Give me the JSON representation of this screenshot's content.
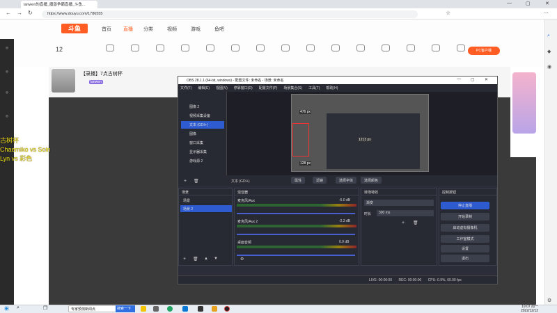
{
  "browser": {
    "tab_title": "lanwen的直播_魔兽争霸直播_斗鱼...",
    "url": "https://www.douyu.com/1786555"
  },
  "site": {
    "logo": "斗鱼",
    "nav": [
      "首页",
      "直播",
      "分类",
      "视频",
      "游戏",
      "鱼吧"
    ],
    "category_count": "12",
    "categories": [
      "",
      "",
      "",
      "",
      "",
      "",
      "",
      "",
      "",
      "",
      "",
      "",
      "",
      "",
      ""
    ],
    "pc_button": "PC客户端",
    "room_title": "【录播】7点古树杯",
    "streamer": "lanwen"
  },
  "overlay_text": [
    "古树杯",
    "Chaemiko vs Soin",
    "Lyn vs 彩色"
  ],
  "obs": {
    "title": "OBS 28.1.1 (64-bit, windows) - 配置文件: 未命名 - 场景: 未命名",
    "menu": [
      "文件(F)",
      "编辑(E)",
      "视图(V)",
      "停靠窗口(D)",
      "配置文件(P)",
      "场景集合(S)",
      "工具(T)",
      "帮助(H)"
    ],
    "sources": [
      "图像 2",
      "视频采集设备",
      "文本 (GDI+)",
      "图像",
      "窗口采集",
      "显示器采集",
      "游戏源 2"
    ],
    "selected_source": "文本 (GDI+)",
    "toolbar_buttons": [
      "属性",
      "滤镜",
      "选择字体",
      "选择颜色"
    ],
    "docks": {
      "scenes": "场景",
      "mixer": "混音器",
      "transitions": "转场特效",
      "controls": "控制按钮"
    },
    "scenes": [
      "场景",
      "场景 2"
    ],
    "mixer": [
      {
        "name": "麦克风/Aux",
        "db": "-5.0 dB"
      },
      {
        "name": "麦克风/Aux 2",
        "db": "-2.3 dB"
      },
      {
        "name": "桌面音频",
        "db": "0.0 dB"
      }
    ],
    "transition": {
      "type": "渐变",
      "duration_label": "时长",
      "duration": "300 ms"
    },
    "controls": [
      "停止直播",
      "开始录制",
      "启动虚拟摄像机",
      "工作室模式",
      "设置",
      "退出"
    ],
    "status": {
      "live": "LIVE: 00:00:00",
      "rec": "REC: 00:00:00",
      "cpu": "CPU: 0.9%, 60.00 fps"
    },
    "dims": {
      "h": "476 px",
      "w": "1213 px",
      "b": "128 px"
    }
  },
  "taskbar": {
    "search_placeholder": "专家预测新闻点",
    "search_button": "搜索一下",
    "time": "19:07 周一",
    "date": "2022/12/12"
  }
}
